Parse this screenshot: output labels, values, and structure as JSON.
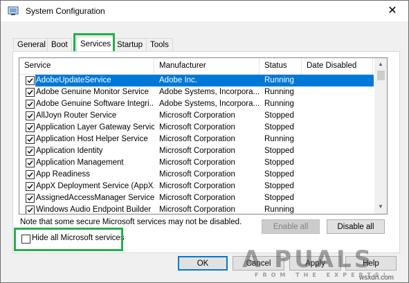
{
  "window": {
    "title": "System Configuration",
    "icon": "system-config-icon",
    "close_glyph": "✕"
  },
  "tabs": [
    {
      "label": "General",
      "active": false
    },
    {
      "label": "Boot",
      "active": false
    },
    {
      "label": "Services",
      "active": true
    },
    {
      "label": "Startup",
      "active": false
    },
    {
      "label": "Tools",
      "active": false
    }
  ],
  "columns": {
    "service": "Service",
    "manufacturer": "Manufacturer",
    "status": "Status",
    "date_disabled": "Date Disabled"
  },
  "services": [
    {
      "name": "AdobeUpdateService",
      "manufacturer": "Adobe Inc.",
      "status": "Running",
      "date_disabled": "",
      "checked": true,
      "selected": true
    },
    {
      "name": "Adobe Genuine Monitor Service",
      "manufacturer": "Adobe Systems, Incorpora...",
      "status": "Running",
      "date_disabled": "",
      "checked": true,
      "selected": false
    },
    {
      "name": "Adobe Genuine Software Integri...",
      "manufacturer": "Adobe Systems, Incorpora...",
      "status": "Running",
      "date_disabled": "",
      "checked": true,
      "selected": false
    },
    {
      "name": "AllJoyn Router Service",
      "manufacturer": "Microsoft Corporation",
      "status": "Stopped",
      "date_disabled": "",
      "checked": true,
      "selected": false
    },
    {
      "name": "Application Layer Gateway Service",
      "manufacturer": "Microsoft Corporation",
      "status": "Stopped",
      "date_disabled": "",
      "checked": true,
      "selected": false
    },
    {
      "name": "Application Host Helper Service",
      "manufacturer": "Microsoft Corporation",
      "status": "Running",
      "date_disabled": "",
      "checked": true,
      "selected": false
    },
    {
      "name": "Application Identity",
      "manufacturer": "Microsoft Corporation",
      "status": "Stopped",
      "date_disabled": "",
      "checked": true,
      "selected": false
    },
    {
      "name": "Application Management",
      "manufacturer": "Microsoft Corporation",
      "status": "Stopped",
      "date_disabled": "",
      "checked": true,
      "selected": false
    },
    {
      "name": "App Readiness",
      "manufacturer": "Microsoft Corporation",
      "status": "Stopped",
      "date_disabled": "",
      "checked": true,
      "selected": false
    },
    {
      "name": "AppX Deployment Service (AppX...",
      "manufacturer": "Microsoft Corporation",
      "status": "Stopped",
      "date_disabled": "",
      "checked": true,
      "selected": false
    },
    {
      "name": "AssignedAccessManager Service",
      "manufacturer": "Microsoft Corporation",
      "status": "Stopped",
      "date_disabled": "",
      "checked": true,
      "selected": false
    },
    {
      "name": "Windows Audio Endpoint Builder",
      "manufacturer": "Microsoft Corporation",
      "status": "Running",
      "date_disabled": "",
      "checked": true,
      "selected": false
    }
  ],
  "note": "Note that some secure Microsoft services may not be disabled.",
  "buttons": {
    "enable_all": "Enable all",
    "disable_all": "Disable all",
    "ok": "OK",
    "cancel": "Cancel",
    "apply": "Apply",
    "help": "Help"
  },
  "hide_ms": {
    "label": "Hide all Microsoft services",
    "checked": false
  },
  "highlight_color": "#21b14a",
  "selection_color": "#0078d7",
  "watermark": {
    "main": "A PUALS",
    "sub": "FROM THE EXPERTS!",
    "site": "wsxdn.com"
  }
}
